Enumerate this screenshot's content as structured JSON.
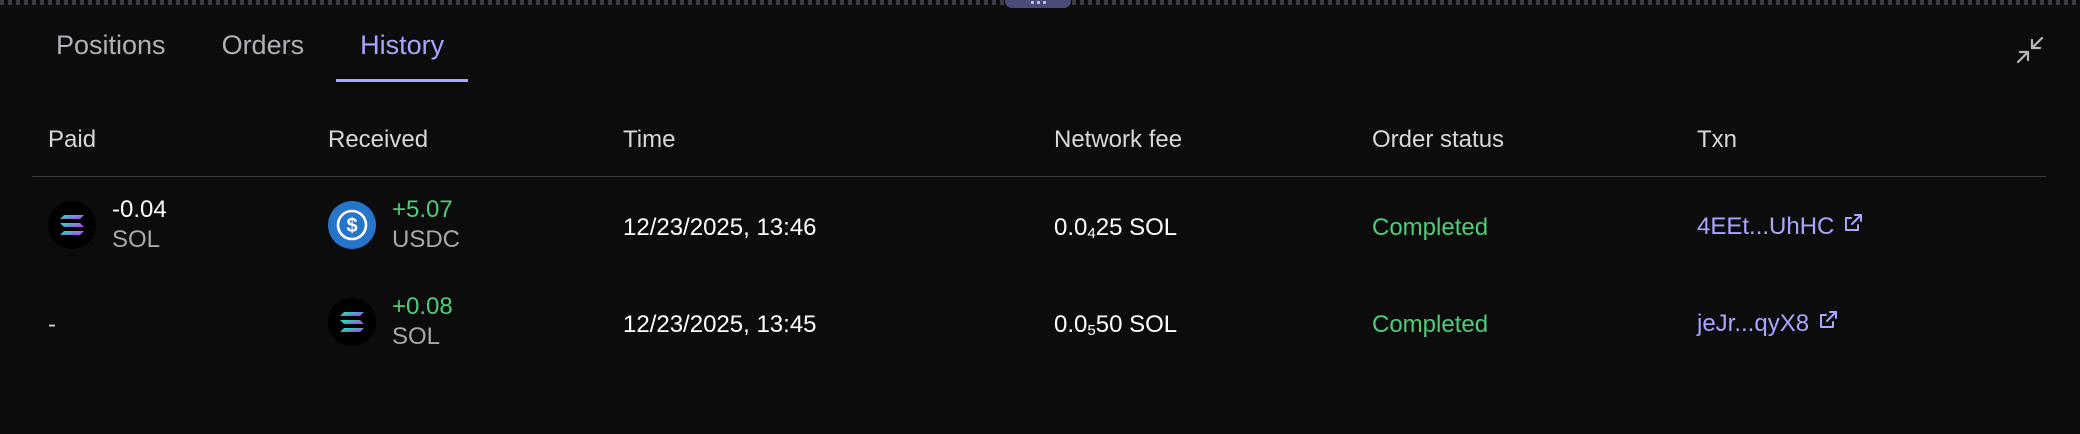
{
  "tabs": [
    {
      "label": "Positions"
    },
    {
      "label": "Orders"
    },
    {
      "label": "History"
    }
  ],
  "active_tab": "History",
  "columns": {
    "paid": "Paid",
    "received": "Received",
    "time": "Time",
    "network_fee": "Network fee",
    "order_status": "Order status",
    "txn": "Txn"
  },
  "rows": [
    {
      "paid": {
        "amount": "-0.04",
        "symbol": "SOL",
        "icon": "solana-icon"
      },
      "received": {
        "amount": "+5.07",
        "symbol": "USDC",
        "icon": "usdc-icon"
      },
      "time": "12/23/2025, 13:46",
      "fee": {
        "prefix": "0.0",
        "zeros": "4",
        "digits": "25",
        "unit": "SOL"
      },
      "status": "Completed",
      "txn": "4EEt...UhHC"
    },
    {
      "paid": {
        "amount": "-"
      },
      "received": {
        "amount": "+0.08",
        "symbol": "SOL",
        "icon": "solana-icon"
      },
      "time": "12/23/2025, 13:45",
      "fee": {
        "prefix": "0.0",
        "zeros": "5",
        "digits": "50",
        "unit": "SOL"
      },
      "status": "Completed",
      "txn": "jeJr...qyX8"
    }
  ],
  "colors": {
    "accent": "#a9a6ff",
    "positive": "#4fcc78",
    "background": "#0c0c0d",
    "usdc": "#2775ca"
  }
}
